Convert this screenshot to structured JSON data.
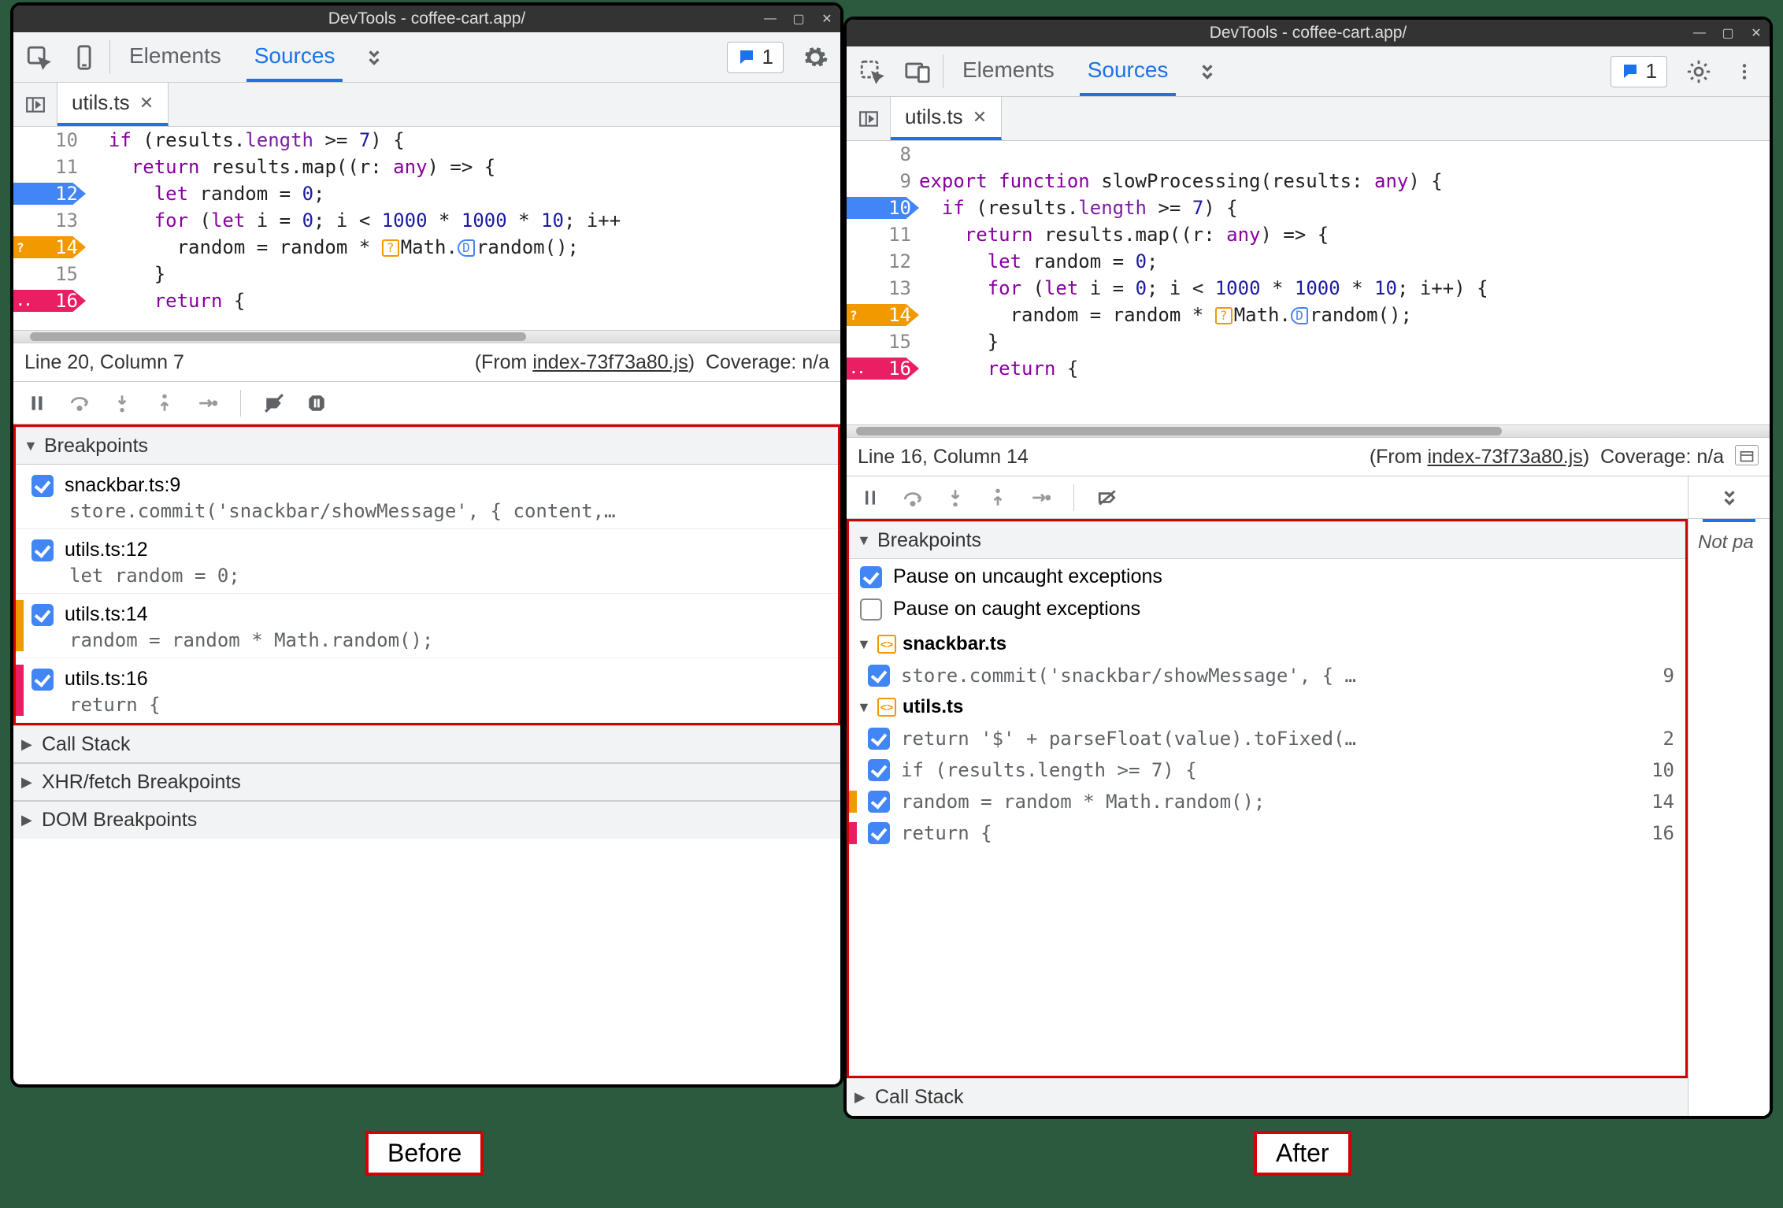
{
  "labels": {
    "before": "Before",
    "after": "After"
  },
  "left": {
    "title": "DevTools - coffee-cart.app/",
    "tabs": {
      "elements": "Elements",
      "sources": "Sources"
    },
    "msg_count": "1",
    "file_tab": "utils.ts",
    "code": {
      "lines": [
        {
          "n": "10",
          "bp": "",
          "html": "  <span class='tok-kw'>if</span> (results.<span class='tok-prop'>length</span> &gt;= <span class='tok-num'>7</span>) {"
        },
        {
          "n": "11",
          "bp": "",
          "html": "    <span class='tok-kw'>return</span> results.<span class='tok-fn'>map</span>((<span>r</span>: <span class='tok-type'>any</span>) =&gt; {"
        },
        {
          "n": "12",
          "bp": "blue",
          "html": "      <span class='tok-kw'>let</span> random = <span class='tok-num'>0</span>;"
        },
        {
          "n": "13",
          "bp": "",
          "html": "      <span class='tok-kw'>for</span> (<span class='tok-kw'>let</span> i = <span class='tok-num'>0</span>; i &lt; <span class='tok-num'>1000</span> * <span class='tok-num'>1000</span> * <span class='tok-num'>10</span>; i++"
        },
        {
          "n": "14",
          "bp": "orange",
          "badge": "?",
          "html": "        random = random * <span class='chip orange'>?</span>Math.<span class='chip blue'>D</span><span class='tok-fn'>random</span>();"
        },
        {
          "n": "15",
          "bp": "",
          "html": "      }"
        },
        {
          "n": "16",
          "bp": "pink",
          "badge": "..",
          "html": "      <span class='tok-kw'>return</span> {"
        }
      ]
    },
    "status": {
      "pos": "Line 20, Column 7",
      "from": "(From ",
      "link": "index-73f73a80.js",
      "close": ")",
      "cov": "Coverage: n/a"
    },
    "sections": {
      "breakpoints": "Breakpoints",
      "callstack": "Call Stack",
      "xhr": "XHR/fetch Breakpoints",
      "dom": "DOM Breakpoints"
    },
    "bps": [
      {
        "title": "snackbar.ts:9",
        "code": "store.commit('snackbar/showMessage', { content,…"
      },
      {
        "title": "utils.ts:12",
        "code": "let random = 0;"
      },
      {
        "title": "utils.ts:14",
        "code": "random = random * Math.random();"
      },
      {
        "title": "utils.ts:16",
        "code": "return {"
      }
    ]
  },
  "right": {
    "title": "DevTools - coffee-cart.app/",
    "tabs": {
      "elements": "Elements",
      "sources": "Sources"
    },
    "msg_count": "1",
    "file_tab": "utils.ts",
    "code": {
      "lines": [
        {
          "n": "8",
          "bp": "",
          "html": ""
        },
        {
          "n": "9",
          "bp": "",
          "html": "<span class='tok-kw'>export</span> <span class='tok-kw'>function</span> <span class='tok-fn'>slowProcessing</span>(results: <span class='tok-type'>any</span>) {"
        },
        {
          "n": "10",
          "bp": "blue",
          "html": "  <span class='tok-kw'>if</span> (results.<span class='tok-prop'>length</span> &gt;= <span class='tok-num'>7</span>) {"
        },
        {
          "n": "11",
          "bp": "",
          "html": "    <span class='tok-kw'>return</span> results.<span class='tok-fn'>map</span>((r: <span class='tok-type'>any</span>) =&gt; {"
        },
        {
          "n": "12",
          "bp": "",
          "html": "      <span class='tok-kw'>let</span> random = <span class='tok-num'>0</span>;"
        },
        {
          "n": "13",
          "bp": "",
          "html": "      <span class='tok-kw'>for</span> (<span class='tok-kw'>let</span> i = <span class='tok-num'>0</span>; i &lt; <span class='tok-num'>1000</span> * <span class='tok-num'>1000</span> * <span class='tok-num'>10</span>; i++) {"
        },
        {
          "n": "14",
          "bp": "orange",
          "badge": "?",
          "html": "        random = random * <span class='chip orange'>?</span>Math.<span class='chip blue'>D</span><span class='tok-fn'>random</span>();"
        },
        {
          "n": "15",
          "bp": "",
          "html": "      }"
        },
        {
          "n": "16",
          "bp": "pink",
          "badge": "..",
          "html": "      <span class='tok-kw'>return</span> {"
        }
      ]
    },
    "status": {
      "pos": "Line 16, Column 14",
      "from": "(From ",
      "link": "index-73f73a80.js",
      "close": ")",
      "cov": "Coverage: n/a"
    },
    "sections": {
      "breakpoints": "Breakpoints",
      "callstack": "Call Stack"
    },
    "pause": {
      "uncaught": "Pause on uncaught exceptions",
      "caught": "Pause on caught exceptions"
    },
    "groups": [
      {
        "file": "snackbar.ts",
        "lines": [
          {
            "src": "store.commit('snackbar/showMessage', { …",
            "ln": "9",
            "stripe": "none"
          }
        ]
      },
      {
        "file": "utils.ts",
        "lines": [
          {
            "src": "return '$' + parseFloat(value).toFixed(…",
            "ln": "2",
            "stripe": "none"
          },
          {
            "src": "if (results.length >= 7) {",
            "ln": "10",
            "stripe": "none"
          },
          {
            "src": "random = random * Math.random();",
            "ln": "14",
            "stripe": "orange"
          },
          {
            "src": "return {",
            "ln": "16",
            "stripe": "pink"
          }
        ]
      }
    ],
    "side_not_paused": "Not pa"
  }
}
